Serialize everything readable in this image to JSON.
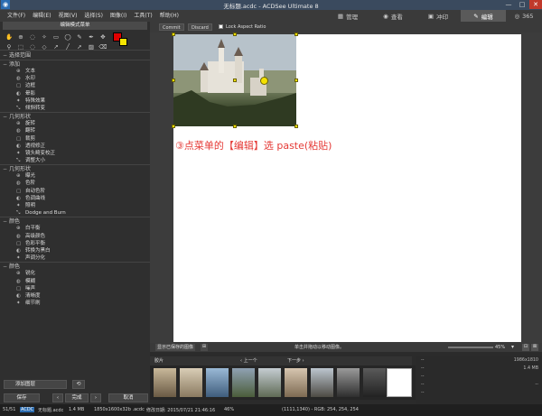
{
  "window": {
    "title": "无标题.acdc - ACDSee Ultimate 8",
    "min": "—",
    "max": "□",
    "close": "✕"
  },
  "menu": [
    "文件(F)",
    "编辑(E)",
    "视图(V)",
    "选择(S)",
    "图像(I)",
    "工具(T)",
    "帮助(H)"
  ],
  "modes": [
    {
      "label": "管理",
      "icon": "grid-icon"
    },
    {
      "label": "查看",
      "icon": "eye-icon"
    },
    {
      "label": "冲印",
      "icon": "develop-icon"
    },
    {
      "label": "编辑",
      "icon": "edit-icon"
    },
    {
      "label": "365",
      "icon": "365-icon"
    }
  ],
  "left": {
    "title": "编辑模式菜单",
    "select_section": "选择范围",
    "sections": [
      {
        "title": "添加",
        "items": [
          "文本",
          "水印",
          "边框",
          "晕影",
          "特殊效果",
          "倾斜转变"
        ]
      },
      {
        "title": "几何形状",
        "items": [
          "旋转",
          "翻转",
          "裁剪",
          "透视修正",
          "镜头畸变校正",
          "调整大小"
        ]
      },
      {
        "title": "几何形状",
        "items": [
          "曝光",
          "色阶",
          "自动色阶",
          "色调曲线",
          "照明",
          "Dodge and Burn"
        ]
      },
      {
        "title": "颜色",
        "items": [
          "白平衡",
          "高级颜色",
          "色彩平衡",
          "转换为黑白",
          "声调分化"
        ]
      },
      {
        "title": "颜色",
        "items": [
          "锐化",
          "模糊",
          "噪声",
          "清晰度",
          "细节刷"
        ]
      }
    ],
    "add_layer": "添加图层",
    "save": "保存",
    "done": "完成",
    "cancel": "取消"
  },
  "editbar": {
    "commit": "Commit",
    "discard": "Discard",
    "lock": "Lock Aspect Ratio"
  },
  "annotation": "③点菜单的【编辑】选 paste(粘贴)",
  "strip": {
    "show_label": "显示已保存的图像",
    "hint": "单击并拖动以移动图像。",
    "zoom": "45%"
  },
  "film": {
    "label": "胶片",
    "prev": "上一个",
    "next": "下一步"
  },
  "info": {
    "res": "1986x1810",
    "size": "1.4 MB",
    "dash": "--"
  },
  "status": {
    "count": "51/51",
    "fmt": "ACDC",
    "file": "无标题.acdc",
    "size": "1.4 MB",
    "dims": "1850x1600x32b .acdc",
    "date": "修改日期: 2015/07/21 21:46:16",
    "zoom": "46%",
    "rgb": "(1111,1340) - RGB: 254, 254, 254"
  }
}
